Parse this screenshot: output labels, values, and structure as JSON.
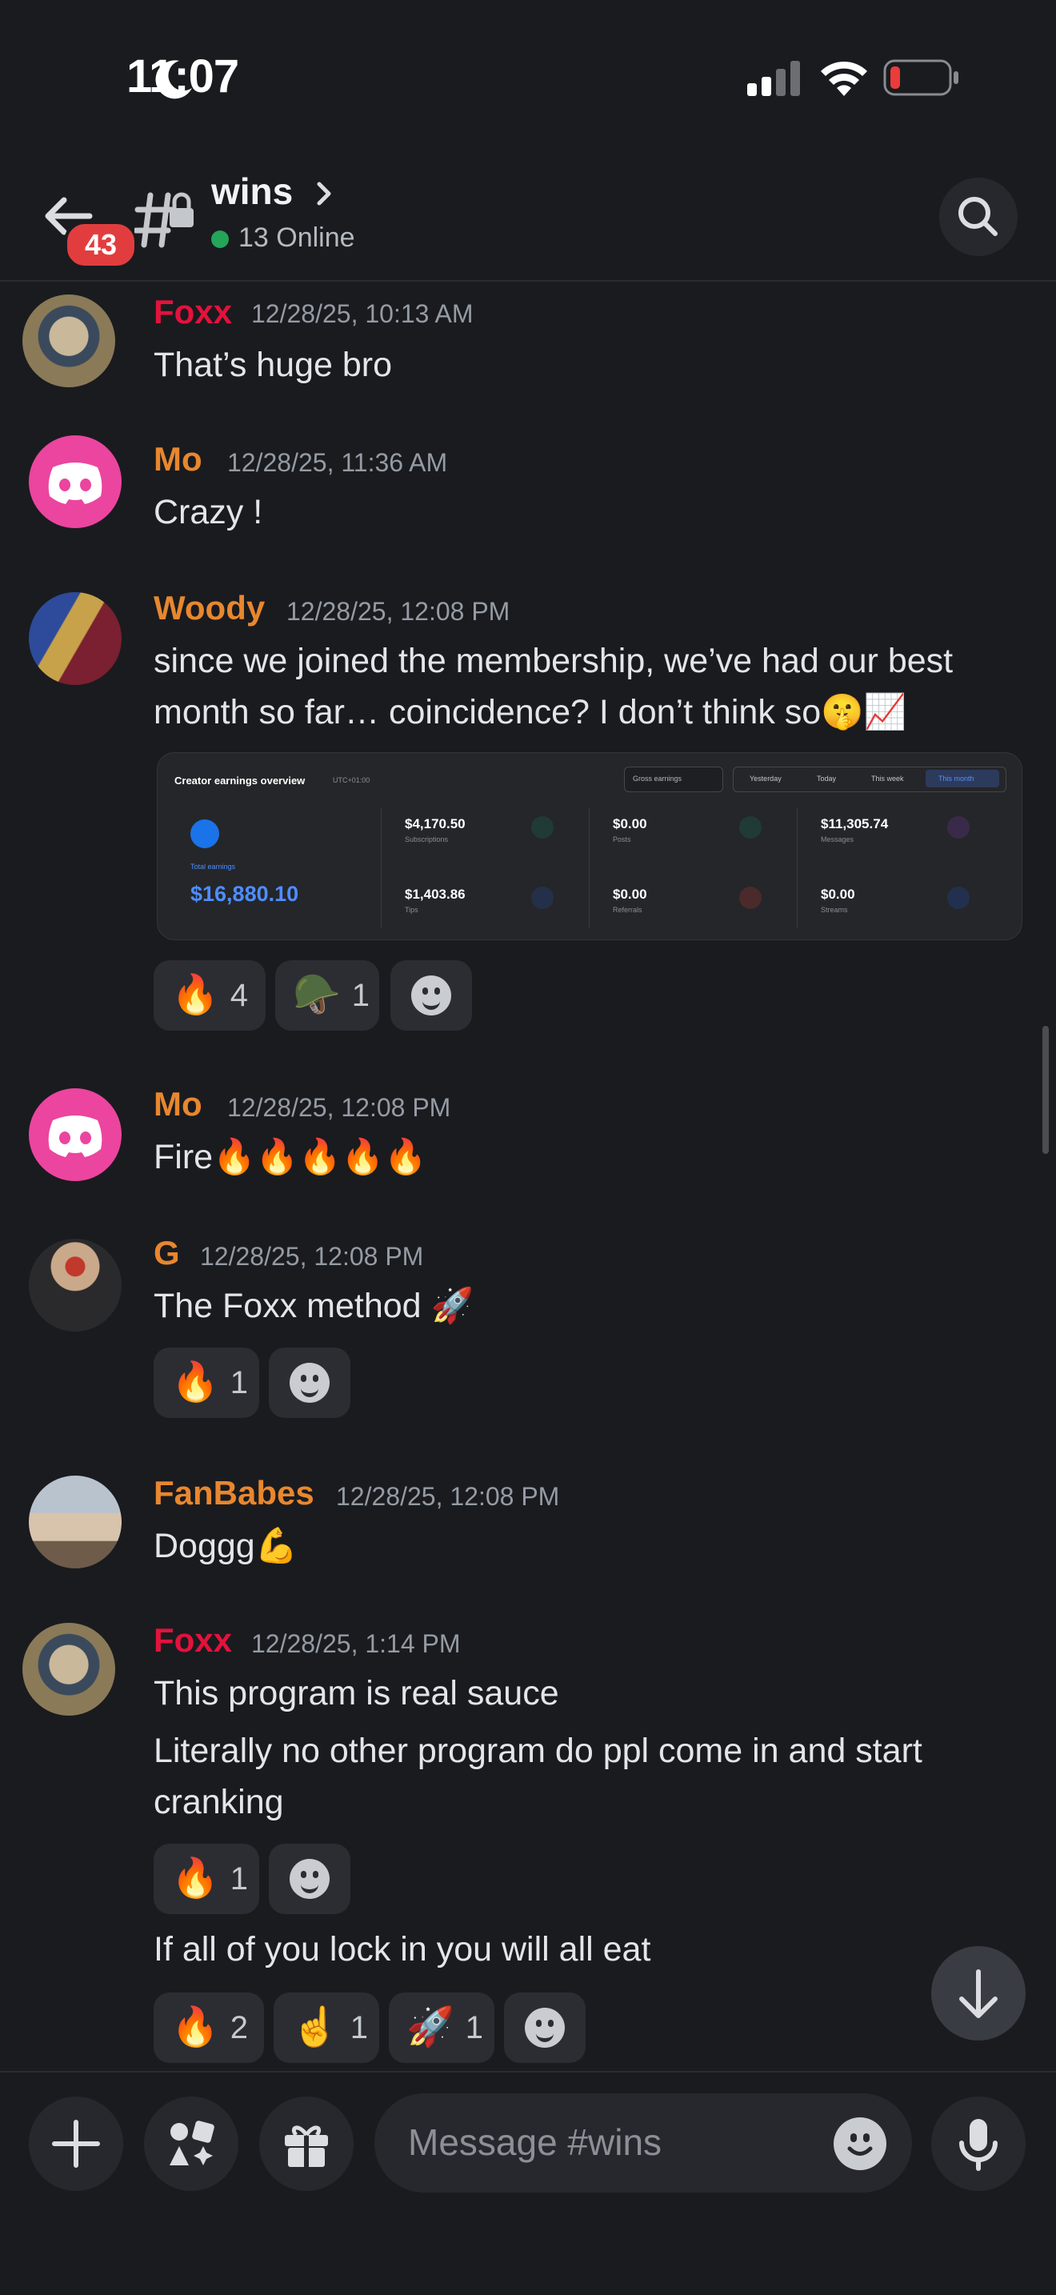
{
  "status_bar": {
    "time": "11:07"
  },
  "header": {
    "unread_count": "43",
    "channel_name": "wins",
    "online_text": "13 Online"
  },
  "messages": [
    {
      "user": "Foxx",
      "user_color": "#e3123c",
      "time": "12/28/25, 10:13 AM",
      "lines": [
        "That’s huge bro"
      ]
    },
    {
      "user": "Mo",
      "user_color": "#e8872e",
      "time": "12/28/25, 11:36 AM",
      "lines": [
        "Crazy !"
      ]
    },
    {
      "user": "Woody",
      "user_color": "#e8872e",
      "time": "12/28/25, 12:08 PM",
      "lines": [
        "since we joined the membership, we’ve had our best",
        "month so far… coincidence? I don’t think so🤫📈"
      ],
      "reactions": [
        {
          "emoji": "🔥",
          "count": "4"
        },
        {
          "emoji": "🪖",
          "count": "1"
        }
      ]
    },
    {
      "user": "Mo",
      "user_color": "#e8872e",
      "time": "12/28/25, 12:08 PM",
      "lines": [
        "Fire🔥🔥🔥🔥🔥"
      ]
    },
    {
      "user": "G",
      "user_color": "#e8872e",
      "time": "12/28/25, 12:08 PM",
      "lines": [
        "The Foxx method 🚀"
      ],
      "reactions": [
        {
          "emoji": "🔥",
          "count": "1"
        }
      ]
    },
    {
      "user": "FanBabes",
      "user_color": "#e8872e",
      "time": "12/28/25, 12:08 PM",
      "lines": [
        "Doggg💪"
      ]
    },
    {
      "user": "Foxx",
      "user_color": "#e3123c",
      "time": "12/28/25, 1:14 PM",
      "lines": [
        "This program is real sauce",
        "Literally no other program do ppl come in and start",
        "cranking"
      ],
      "reactions": [
        {
          "emoji": "🔥",
          "count": "1"
        }
      ]
    },
    {
      "continuation": true,
      "lines": [
        "If all of you lock in you will all eat"
      ],
      "reactions": [
        {
          "emoji": "🔥",
          "count": "2"
        },
        {
          "emoji": "☝️",
          "count": "1"
        },
        {
          "emoji": "🚀",
          "count": "1"
        }
      ]
    }
  ],
  "attachment": {
    "title": "Creator earnings overview",
    "timezone": "UTC+01:00",
    "dropdown": "Gross earnings",
    "tabs": [
      "Yesterday",
      "Today",
      "This week",
      "This month"
    ],
    "active_tab": "This month",
    "total_label": "Total earnings",
    "total_value": "$16,880.10",
    "cells": [
      {
        "value": "$4,170.50",
        "label": "Subscriptions"
      },
      {
        "value": "$0.00",
        "label": "Posts"
      },
      {
        "value": "$11,305.74",
        "label": "Messages"
      },
      {
        "value": "$1,403.86",
        "label": "Tips"
      },
      {
        "value": "$0.00",
        "label": "Referrals"
      },
      {
        "value": "$0.00",
        "label": "Streams"
      }
    ]
  },
  "composer": {
    "placeholder": "Message #wins"
  },
  "colors": {
    "background": "#1a1b1f",
    "mention_red": "#e23d3e",
    "online_green": "#23a55a",
    "discord_pink": "#eb459f"
  }
}
